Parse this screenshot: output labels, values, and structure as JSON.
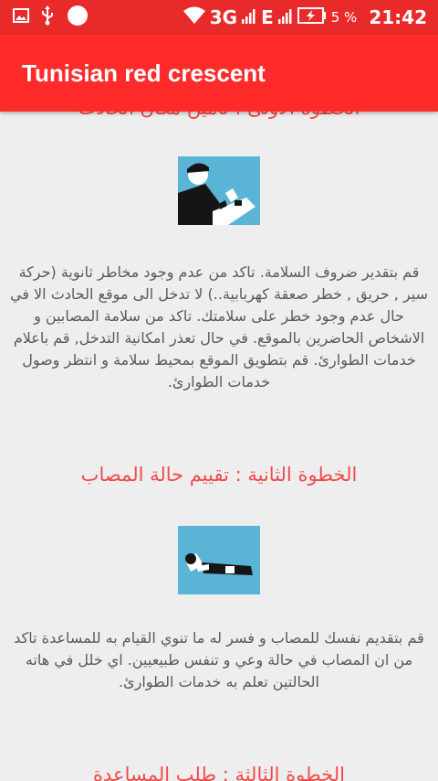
{
  "status_bar": {
    "network": "3G",
    "network2": "E",
    "battery_percent": "5 %",
    "time": "21:42",
    "icons": [
      "image-icon",
      "usb-icon",
      "circle-icon",
      "wifi-icon",
      "signal-icon",
      "signal-icon",
      "battery-charging-icon"
    ]
  },
  "app_bar": {
    "title": "Tunisian red crescent"
  },
  "colors": {
    "status_bar": "#e82a2a",
    "app_bar": "#ff2b2b",
    "heading": "#f04a4a",
    "image_bg": "#5ab4d6"
  },
  "steps": [
    {
      "heading": "الخطوة الأولى : تأمين مكان الحادث",
      "image": "person-checking-victim-image",
      "text": "قم بتقدير ضروف السلامة. تاكد من عدم وجود مخاطر ثانوية (حركة سير , حريق , خطر صعقة كهربابية..) لا تدخل الى موقع الحادث الا في حال عدم وجود خطر على سلامتك. تاكد من سلامة المصابين و الاشخاص الحاضرين بالموقع. في حال تعذر امكانية التدخل, قم باعلام خدمات الطوارئ. قم بتطويق الموقع بمحيط سلامة و انتظر وصول خدمات الطوارئ."
    },
    {
      "heading": "الخطوة الثانية : تقييم حالة المصاب",
      "image": "person-lying-down-image",
      "text": "قم بتقديم نفسك للمصاب و فسر له ما تنوي القيام به للمساعدة تاكد من ان المصاب في حالة وعي و تنفس طبيعيين. اي خلل في هاته الحالتين تعلم به خدمات الطوارئ."
    },
    {
      "heading": "الخطوة الثالثة : طلب المساعدة"
    }
  ]
}
